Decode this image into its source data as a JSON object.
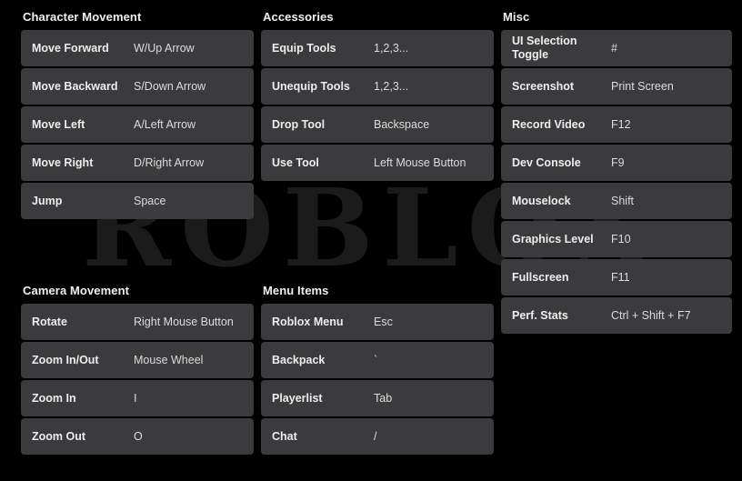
{
  "theme": {
    "background": "#000000",
    "row_background": "#3b3b3d",
    "title_color": "#f0f0f0",
    "action_color": "#ededed",
    "keybind_color": "#dcdcdc",
    "watermark_color": "#1b1b1b"
  },
  "watermark": {
    "text": "ROBLOX"
  },
  "groups": [
    {
      "id": "character-movement",
      "title": "Character Movement",
      "rows": [
        {
          "action": "Move Forward",
          "keybind": "W/Up Arrow"
        },
        {
          "action": "Move Backward",
          "keybind": "S/Down Arrow"
        },
        {
          "action": "Move Left",
          "keybind": "A/Left Arrow"
        },
        {
          "action": "Move Right",
          "keybind": "D/Right Arrow"
        },
        {
          "action": "Jump",
          "keybind": "Space"
        }
      ]
    },
    {
      "id": "camera-movement",
      "title": "Camera Movement",
      "rows": [
        {
          "action": "Rotate",
          "keybind": "Right Mouse Button"
        },
        {
          "action": "Zoom In/Out",
          "keybind": "Mouse Wheel"
        },
        {
          "action": "Zoom In",
          "keybind": "I"
        },
        {
          "action": "Zoom Out",
          "keybind": "O"
        }
      ]
    },
    {
      "id": "accessories",
      "title": "Accessories",
      "rows": [
        {
          "action": "Equip Tools",
          "keybind": "1,2,3..."
        },
        {
          "action": "Unequip Tools",
          "keybind": "1,2,3..."
        },
        {
          "action": "Drop Tool",
          "keybind": "Backspace"
        },
        {
          "action": "Use Tool",
          "keybind": "Left Mouse Button"
        }
      ]
    },
    {
      "id": "menu-items",
      "title": "Menu Items",
      "rows": [
        {
          "action": "Roblox Menu",
          "keybind": "Esc"
        },
        {
          "action": "Backpack",
          "keybind": "`"
        },
        {
          "action": "Playerlist",
          "keybind": "Tab"
        },
        {
          "action": "Chat",
          "keybind": "/"
        }
      ]
    },
    {
      "id": "misc",
      "title": "Misc",
      "rows": [
        {
          "action": "UI Selection Toggle",
          "keybind": "#"
        },
        {
          "action": "Screenshot",
          "keybind": "Print Screen"
        },
        {
          "action": "Record Video",
          "keybind": "F12"
        },
        {
          "action": "Dev Console",
          "keybind": "F9"
        },
        {
          "action": "Mouselock",
          "keybind": "Shift"
        },
        {
          "action": "Graphics Level",
          "keybind": "F10"
        },
        {
          "action": "Fullscreen",
          "keybind": "F11"
        },
        {
          "action": "Perf. Stats",
          "keybind": "Ctrl + Shift + F7"
        }
      ]
    }
  ]
}
